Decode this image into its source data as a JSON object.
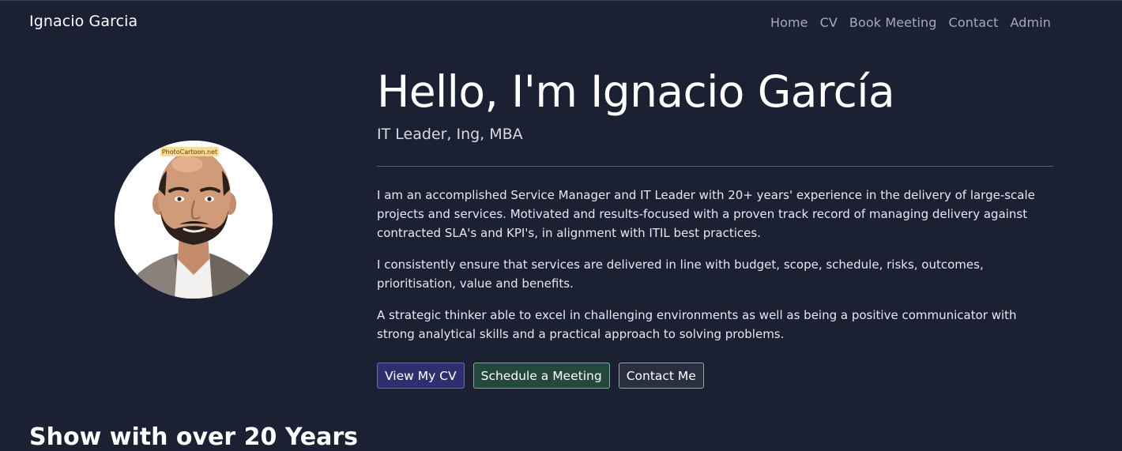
{
  "navbar": {
    "brand": "Ignacio Garcia",
    "links": [
      {
        "label": "Home"
      },
      {
        "label": "CV"
      },
      {
        "label": "Book Meeting"
      },
      {
        "label": "Contact"
      },
      {
        "label": "Admin"
      }
    ]
  },
  "hero": {
    "title": "Hello, I'm Ignacio García",
    "subtitle": "IT Leader, Ing, MBA",
    "avatar_watermark": "PhotoCartoon.net",
    "paragraphs": [
      "I am an accomplished Service Manager and IT Leader with 20+ years' experience in the delivery of large-scale projects and services. Motivated and results-focused with a proven track record of managing delivery against contracted SLA's and KPI's, in alignment with ITIL best practices.",
      "I consistently ensure that services are delivered in line with budget, scope, schedule, risks, outcomes, prioritisation, value and benefits.",
      "A strategic thinker able to excel in challenging environments as well as being a positive communicator with strong analytical skills and a practical approach to solving problems."
    ],
    "buttons": {
      "cv": "View My CV",
      "meeting": "Schedule a Meeting",
      "contact": "Contact Me"
    }
  },
  "next_section": {
    "heading": "Show with over 20 Years"
  },
  "colors": {
    "background": "#1c2033",
    "nav_link": "#a7abb7",
    "btn_cv_border": "#6d5fe0",
    "btn_meeting_border": "#5fbf83",
    "btn_contact_border": "#9ea3b0"
  }
}
